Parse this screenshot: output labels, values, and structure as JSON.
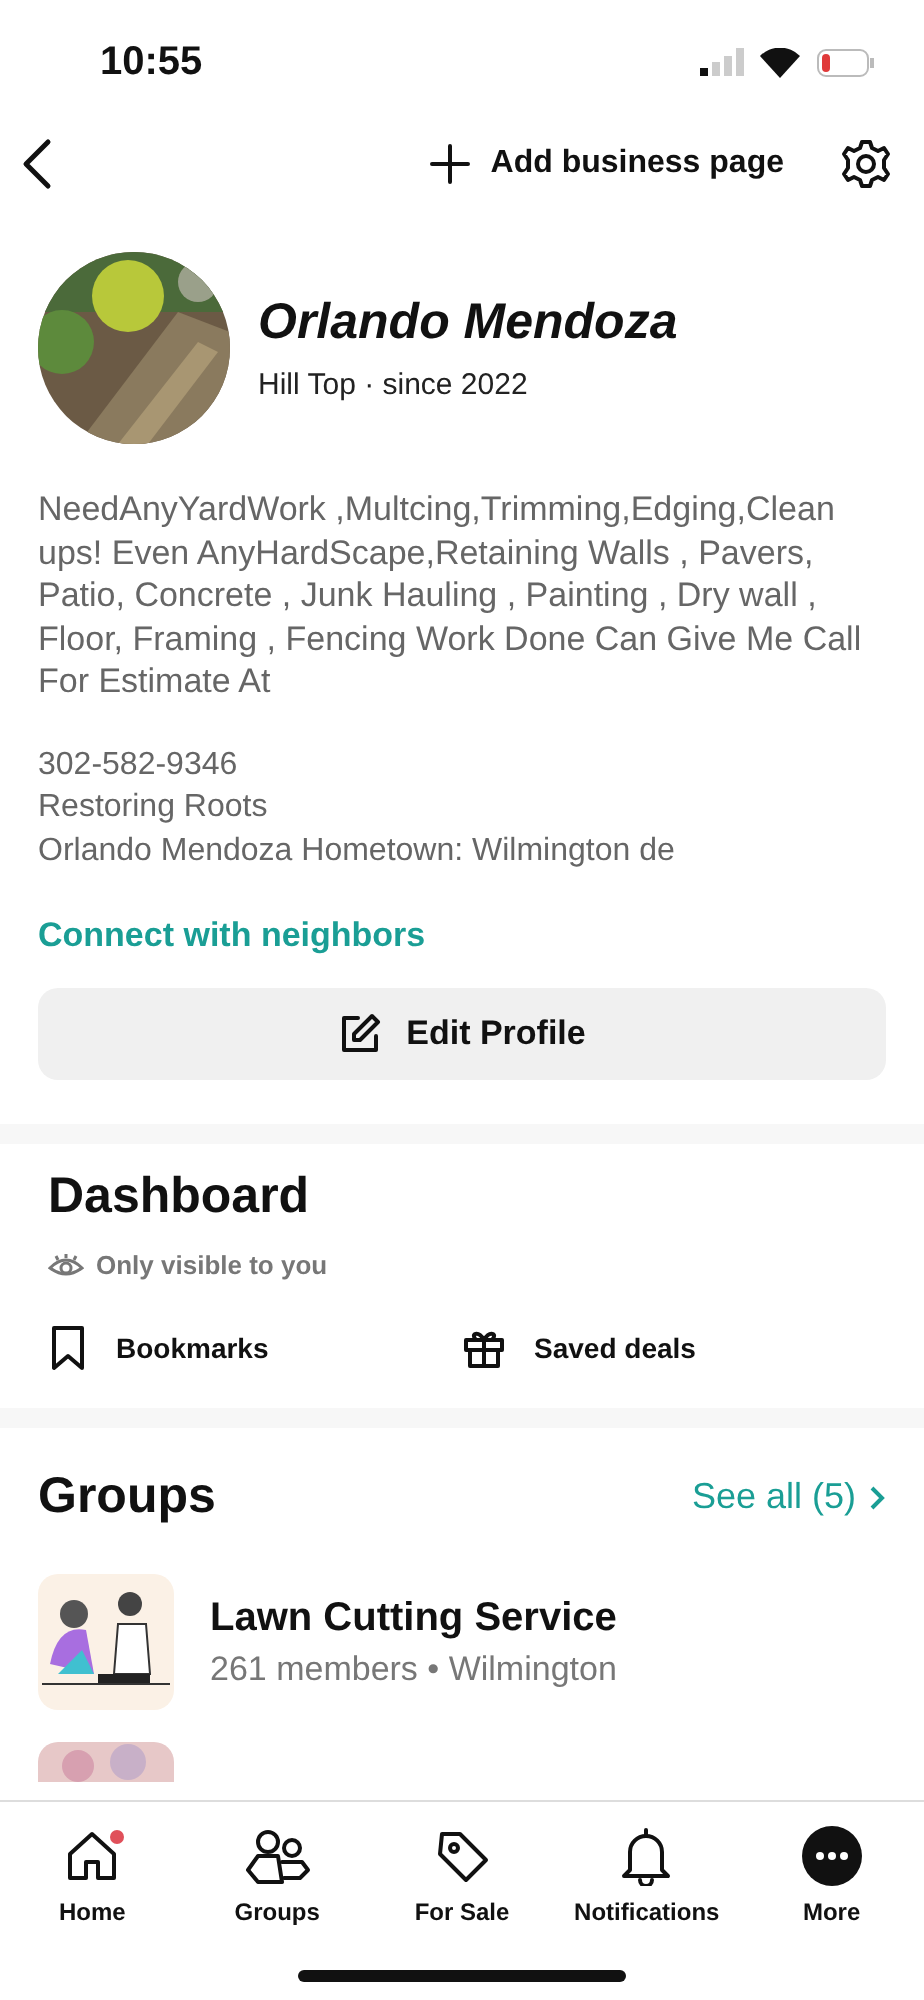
{
  "status_bar": {
    "time": "10:55"
  },
  "top_bar": {
    "action": "Add business page"
  },
  "profile": {
    "name": "Orlando Mendoza",
    "subtitle": "Hill Top · since 2022",
    "bio": "NeedAnyYardWork ,Multcing,Trimming,Edging,Clean ups! Even AnyHardScape,Retaining Walls , Pavers, Patio, Concrete , Junk Hauling , Painting , Dry wall , Floor, Framing , Fencing Work Done Can Give Me Call For Estimate At",
    "details": [
      "302-582-9346",
      "Restoring Roots",
      "Orlando Mendoza Hometown:  Wilmington de"
    ],
    "link": "Connect with neighbors",
    "edit_button": "Edit Profile"
  },
  "dashboard": {
    "title": "Dashboard",
    "note": "Only visible to you",
    "items": [
      {
        "kind": "bookmark",
        "label": "Bookmarks"
      },
      {
        "kind": "gift",
        "label": "Saved deals"
      }
    ]
  },
  "groups": {
    "title": "Groups",
    "see_all": "See all (5)",
    "items": [
      {
        "name": "Lawn Cutting Service",
        "meta": "261 members • Wilmington"
      }
    ]
  },
  "tab_bar": [
    {
      "kind": "home",
      "label": "Home",
      "badge": true
    },
    {
      "kind": "groups",
      "label": "Groups",
      "badge": false
    },
    {
      "kind": "sale",
      "label": "For Sale",
      "badge": false
    },
    {
      "kind": "bell",
      "label": "Notifications",
      "badge": false
    },
    {
      "kind": "more",
      "label": "More",
      "badge": false
    }
  ]
}
